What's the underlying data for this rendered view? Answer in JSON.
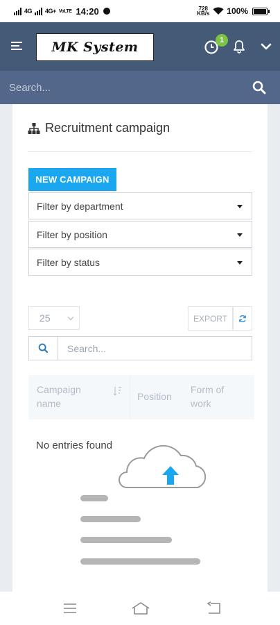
{
  "status_bar": {
    "time": "14:20",
    "signal_left": "4G",
    "signal_right": "4G+",
    "network_small": "VoLTE",
    "speed_small": "728 KB/s",
    "battery": "100%"
  },
  "header": {
    "logo_text": "MK System",
    "notification_count": "1"
  },
  "search": {
    "placeholder": "Search..."
  },
  "page": {
    "title": "Recruitment campaign",
    "new_button": "NEW CAMPAIGN",
    "filters": [
      {
        "label": "Filter by department"
      },
      {
        "label": "Filter by position"
      },
      {
        "label": "Filter by status"
      }
    ],
    "page_size": "25",
    "export_label": "EXPORT",
    "table_search_placeholder": "Search...",
    "columns": [
      "Campaign name",
      "Position",
      "Form of work"
    ],
    "empty_message": "No entries found"
  },
  "colors": {
    "header": "#455a76",
    "searchbar": "#52678a",
    "primary_button": "#1ba7f0",
    "badge": "#7cc544",
    "upload_arrow": "#1ba7f0"
  },
  "icons": [
    "menu-icon",
    "clock-icon",
    "bell-icon",
    "chevron-down-icon",
    "search-icon",
    "sitemap-icon",
    "refresh-icon",
    "sort-icon",
    "cloud-upload-icon",
    "nav-menu-icon",
    "nav-home-icon",
    "nav-back-icon"
  ]
}
